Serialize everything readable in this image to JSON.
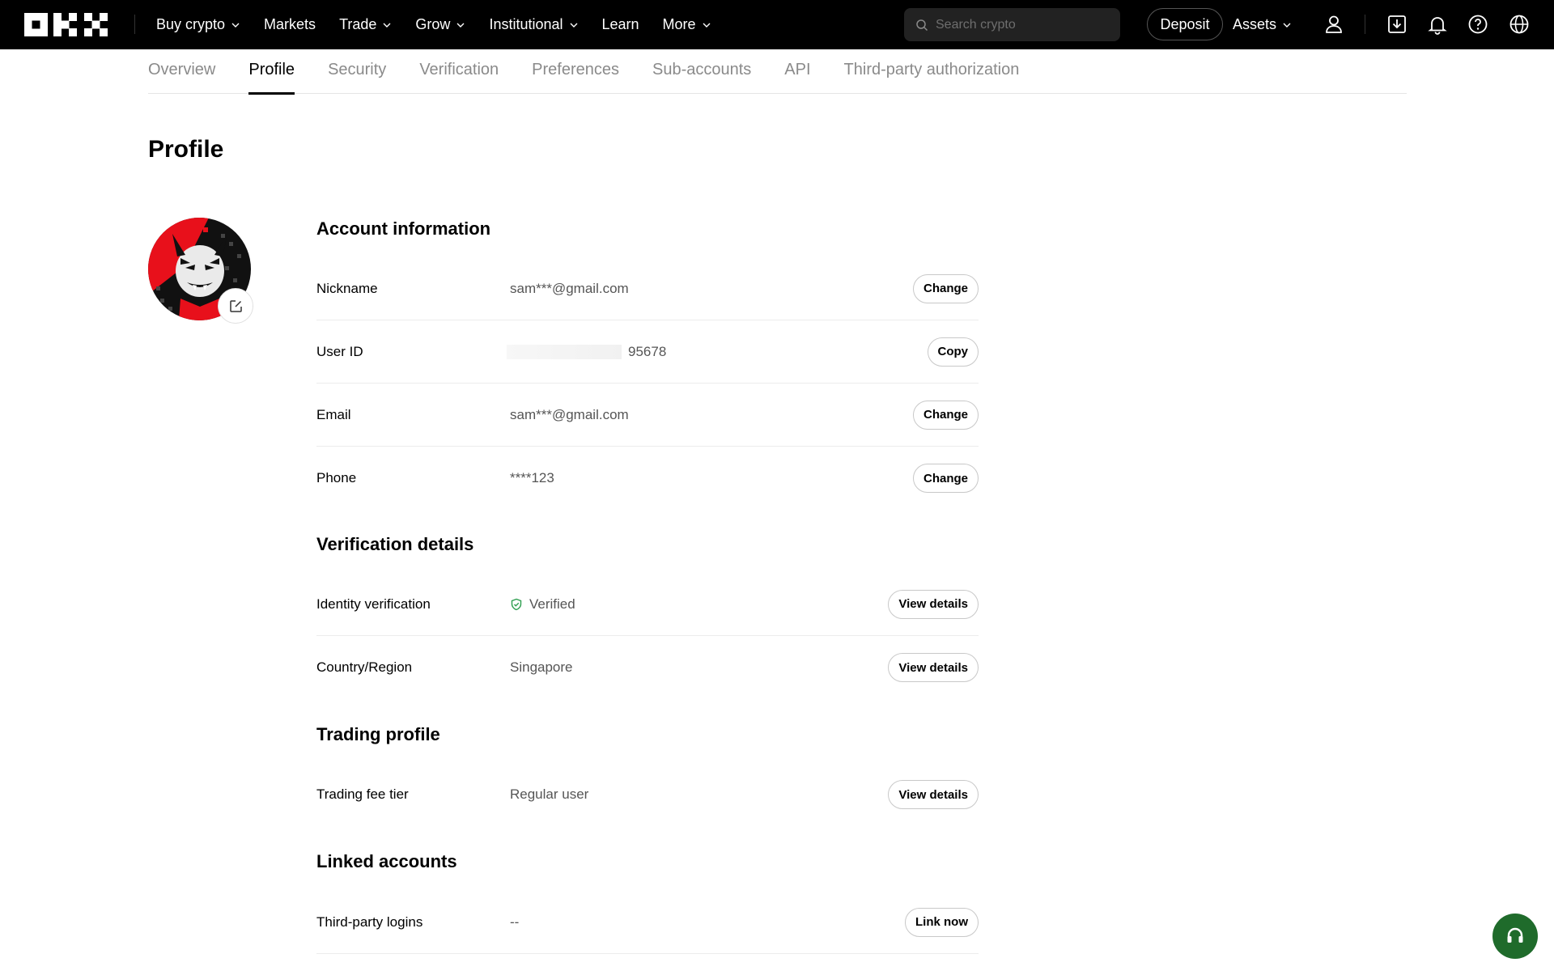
{
  "nav": {
    "items": [
      {
        "label": "Buy crypto",
        "dropdown": true
      },
      {
        "label": "Markets",
        "dropdown": false
      },
      {
        "label": "Trade",
        "dropdown": true
      },
      {
        "label": "Grow",
        "dropdown": true
      },
      {
        "label": "Institutional",
        "dropdown": true
      },
      {
        "label": "Learn",
        "dropdown": false
      },
      {
        "label": "More",
        "dropdown": true
      }
    ],
    "search_placeholder": "Search crypto",
    "deposit_label": "Deposit",
    "assets_label": "Assets"
  },
  "tabs": [
    {
      "label": "Overview",
      "active": false
    },
    {
      "label": "Profile",
      "active": true
    },
    {
      "label": "Security",
      "active": false
    },
    {
      "label": "Verification",
      "active": false
    },
    {
      "label": "Preferences",
      "active": false
    },
    {
      "label": "Sub-accounts",
      "active": false
    },
    {
      "label": "API",
      "active": false
    },
    {
      "label": "Third-party authorization",
      "active": false
    }
  ],
  "page_title": "Profile",
  "account_info": {
    "title": "Account information",
    "rows": [
      {
        "label": "Nickname",
        "value": "sam***@gmail.com",
        "button": "Change"
      },
      {
        "label": "User ID",
        "value": "95678",
        "button": "Copy"
      },
      {
        "label": "Email",
        "value": "sam***@gmail.com",
        "button": "Change"
      },
      {
        "label": "Phone",
        "value": "****123",
        "button": "Change"
      }
    ]
  },
  "verification": {
    "title": "Verification details",
    "rows": [
      {
        "label": "Identity verification",
        "value": "Verified",
        "button": "View details"
      },
      {
        "label": "Country/Region",
        "value": "Singapore",
        "button": "View details"
      }
    ]
  },
  "trading": {
    "title": "Trading profile",
    "rows": [
      {
        "label": "Trading fee tier",
        "value": "Regular user",
        "button": "View details"
      }
    ]
  },
  "linked": {
    "title": "Linked accounts",
    "rows": [
      {
        "label": "Third-party logins",
        "value": "--",
        "button": "Link now"
      }
    ]
  },
  "colors": {
    "topbar_bg": "#000000",
    "verified_green": "#2e9e4f",
    "support_green": "#1f6b2b"
  },
  "icons": [
    "okx-logo",
    "search-icon",
    "user-icon",
    "download-icon",
    "bell-icon",
    "help-icon",
    "globe-icon",
    "edit-icon",
    "shield-check-icon",
    "headset-icon"
  ]
}
